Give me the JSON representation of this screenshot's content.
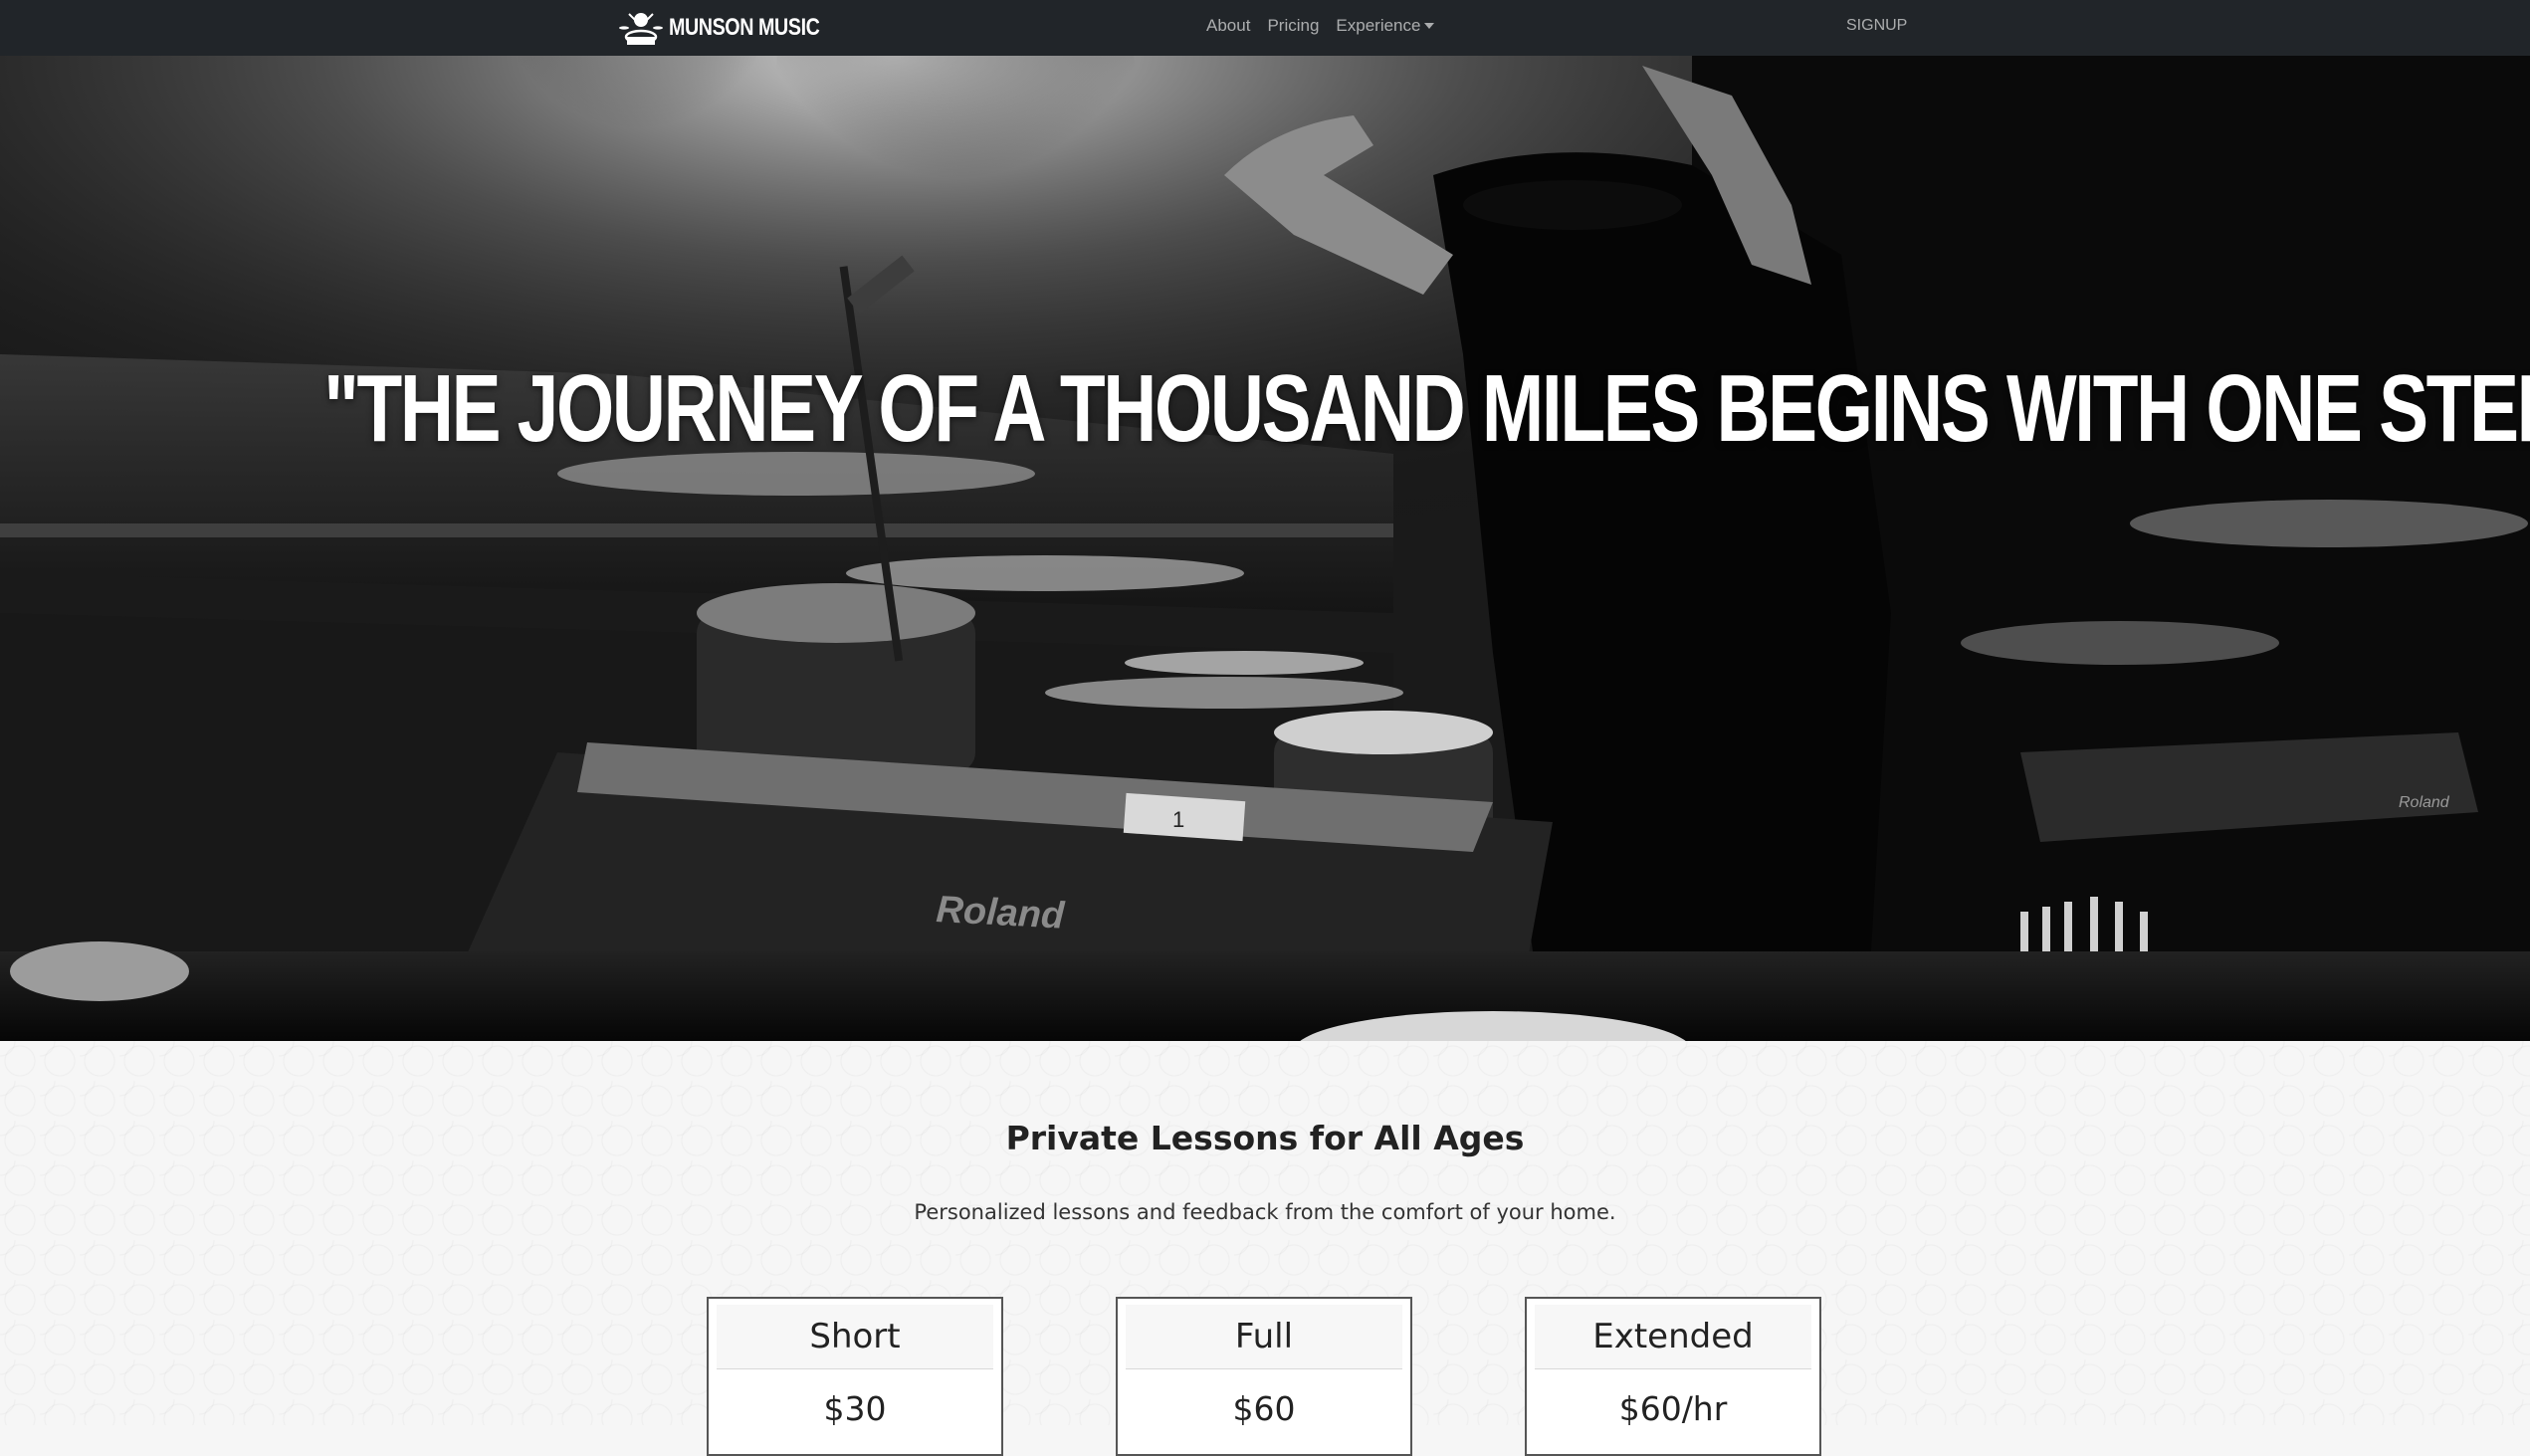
{
  "nav": {
    "brand": "MUNSON MUSIC",
    "links": [
      "About",
      "Pricing",
      "Experience"
    ],
    "signup": "SIGNUP"
  },
  "hero": {
    "quote": "\"THE JOURNEY OF A THOUSAND MILES BEGINS WITH ONE STEP!\"",
    "background_image": "black-and-white photo of a drummer performing on stage with a drum kit facing a concert crowd",
    "image_text": [
      "Roland",
      "Roland",
      "1"
    ]
  },
  "section": {
    "title": "Private Lessons for All Ages",
    "subtitle": "Personalized lessons and feedback from the comfort of your home."
  },
  "plans": [
    {
      "name": "Short",
      "price": "$30"
    },
    {
      "name": "Full",
      "price": "$60"
    },
    {
      "name": "Extended",
      "price": "$60/hr"
    }
  ],
  "colors": {
    "navbar_bg": "#212529",
    "nav_text": "#9a9da0",
    "page_bg": "#f6f6f6",
    "card_border": "#555555"
  },
  "icons": {
    "brand_logo": "drummer-logo-icon",
    "dropdown": "caret-down-icon"
  }
}
